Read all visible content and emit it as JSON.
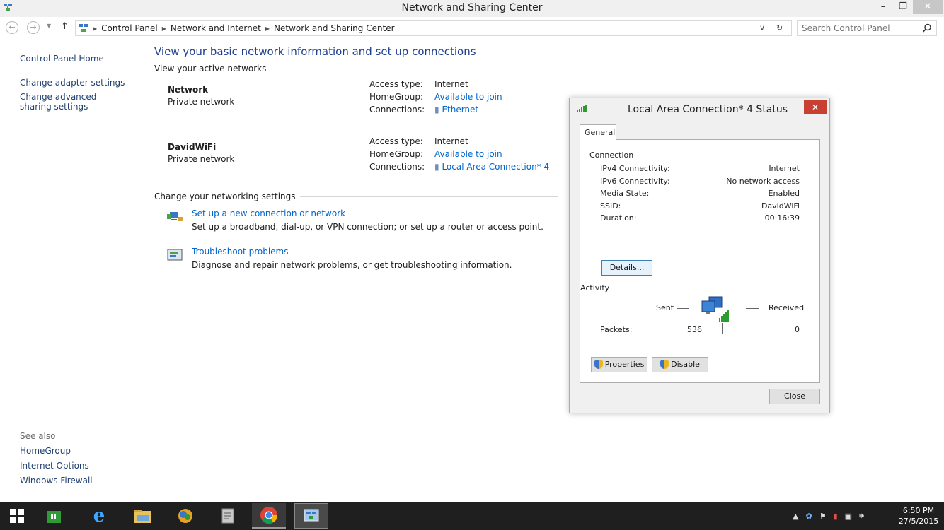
{
  "window": {
    "title": "Network and Sharing Center"
  },
  "address": {
    "crumbs": [
      "Control Panel",
      "Network and Internet",
      "Network and Sharing Center"
    ],
    "search_placeholder": "Search Control Panel"
  },
  "leftnav": {
    "home": "Control Panel Home",
    "items": [
      "Change adapter settings",
      "Change advanced sharing settings"
    ]
  },
  "seealso": {
    "header": "See also",
    "items": [
      "HomeGroup",
      "Internet Options",
      "Windows Firewall"
    ]
  },
  "main": {
    "heading": "View your basic network information and set up connections",
    "active_networks_header": "View your active networks",
    "networks": [
      {
        "name": "Network",
        "category": "Private network",
        "access_type_label": "Access type:",
        "access_type": "Internet",
        "homegroup_label": "HomeGroup:",
        "homegroup": "Available to join",
        "connections_label": "Connections:",
        "connection": "Ethernet"
      },
      {
        "name": "DavidWiFi",
        "category": "Private network",
        "access_type_label": "Access type:",
        "access_type": "Internet",
        "homegroup_label": "HomeGroup:",
        "homegroup": "Available to join",
        "connections_label": "Connections:",
        "connection": "Local Area Connection* 4"
      }
    ],
    "settings_header": "Change your networking settings",
    "tasks": [
      {
        "title": "Set up a new connection or network",
        "desc": "Set up a broadband, dial-up, or VPN connection; or set up a router or access point."
      },
      {
        "title": "Troubleshoot problems",
        "desc": "Diagnose and repair network problems, or get troubleshooting information."
      }
    ]
  },
  "dialog": {
    "title": "Local Area Connection* 4 Status",
    "tab": "General",
    "connection_header": "Connection",
    "rows": [
      {
        "label": "IPv4 Connectivity:",
        "value": "Internet"
      },
      {
        "label": "IPv6 Connectivity:",
        "value": "No network access"
      },
      {
        "label": "Media State:",
        "value": "Enabled"
      },
      {
        "label": "SSID:",
        "value": "DavidWiFi"
      },
      {
        "label": "Duration:",
        "value": "00:16:39"
      }
    ],
    "details_button": "Details...",
    "activity_header": "Activity",
    "sent_label": "Sent",
    "received_label": "Received",
    "packets_label": "Packets:",
    "packets_sent": "536",
    "packets_received": "0",
    "properties_button": "Properties",
    "disable_button": "Disable",
    "close_button": "Close"
  },
  "taskbar": {
    "time": "6:50 PM",
    "date": "27/5/2015"
  },
  "colors": {
    "link": "#0066cc",
    "heading": "#1e3f8f",
    "taskbar": "#1f1f20",
    "close_red": "#c84031"
  }
}
